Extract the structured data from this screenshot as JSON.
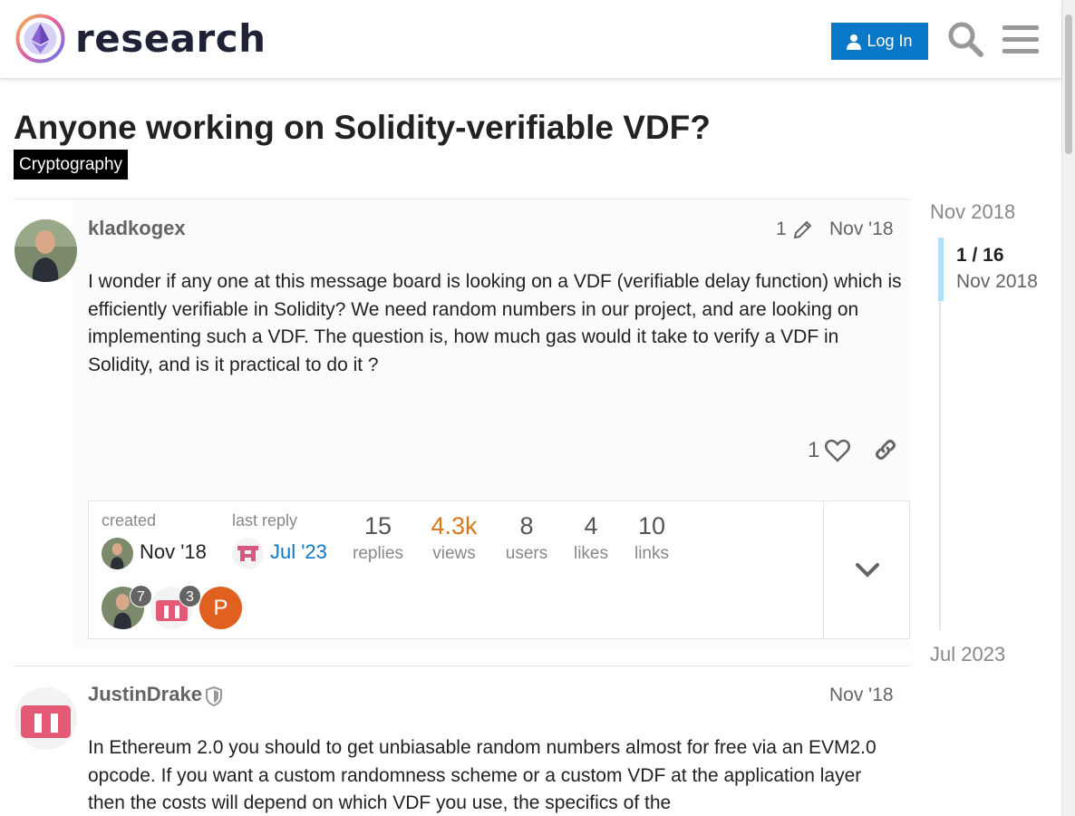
{
  "header": {
    "site_name": "research",
    "login_label": "Log In"
  },
  "topic": {
    "title": "Anyone working on Solidity-verifiable VDF?",
    "category": "Cryptography"
  },
  "posts": [
    {
      "username": "kladkogex",
      "edit_count": "1",
      "date": "Nov '18",
      "body": "I wonder if any one at this message board is looking on a VDF (verifiable delay function) which is efficiently verifiable in Solidity? We need random numbers in our project, and are looking on implementing such a VDF. The question is, how much gas would it take to verify a VDF in Solidity, and is it practical to do it ?",
      "likes": "1"
    },
    {
      "username": "JustinDrake",
      "date": "Nov '18",
      "body": "In Ethereum 2.0 you should to get unbiasable random numbers almost for free via an EVM2.0 opcode. If you want a custom randomness scheme or a custom VDF at the application layer then the costs will depend on which VDF you use, the specifics of the"
    }
  ],
  "topic_map": {
    "created_label": "created",
    "created_date": "Nov '18",
    "last_reply_label": "last reply",
    "last_reply_date": "Jul '23",
    "stats": [
      {
        "num": "15",
        "label": "replies"
      },
      {
        "num": "4.3k",
        "label": "views"
      },
      {
        "num": "8",
        "label": "users"
      },
      {
        "num": "4",
        "label": "likes"
      },
      {
        "num": "10",
        "label": "links"
      }
    ],
    "participants": [
      {
        "count": "7"
      },
      {
        "count": "3"
      },
      {
        "letter": "P"
      }
    ]
  },
  "timeline": {
    "start": "Nov 2018",
    "position": "1 / 16",
    "position_date": "Nov 2018",
    "end": "Jul 2023"
  },
  "colors": {
    "accent": "#0a78c8",
    "views_highlight": "#d6791e",
    "last_reply_link": "#0a78c8"
  }
}
